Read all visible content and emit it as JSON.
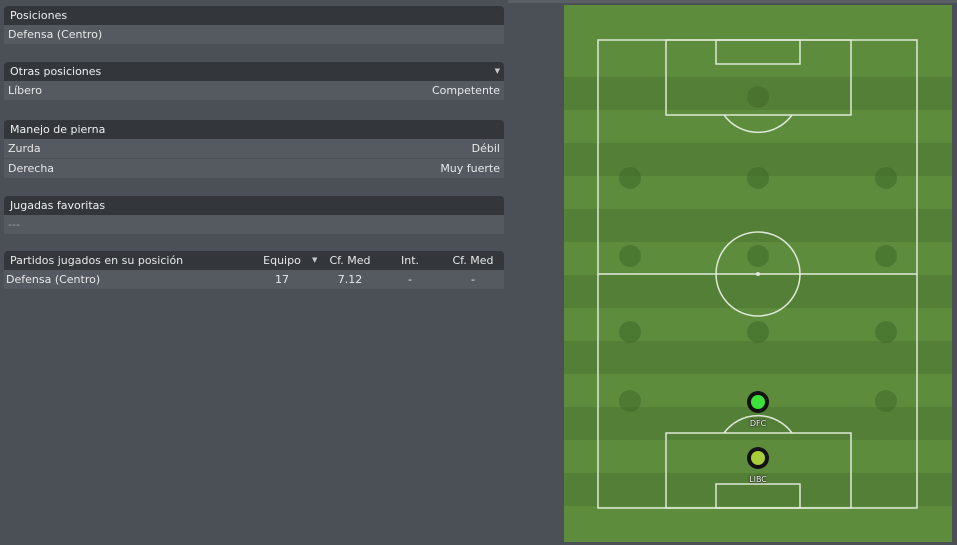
{
  "positions": {
    "title": "Posiciones",
    "value": "Defensa (Centro)"
  },
  "other_positions": {
    "title": "Otras posiciones",
    "rows": [
      {
        "label": "Líbero",
        "value": "Competente"
      }
    ]
  },
  "footedness": {
    "title": "Manejo de pierna",
    "rows": [
      {
        "label": "Zurda",
        "value": "Débil"
      },
      {
        "label": "Derecha",
        "value": "Muy fuerte"
      }
    ]
  },
  "favourite_moves": {
    "title": "Jugadas favoritas",
    "value": "---"
  },
  "matches_table": {
    "headers": [
      "Partidos jugados en su posición",
      "Equipo",
      "Cf. Med",
      "Int.",
      "Cf. Med"
    ],
    "rows": [
      {
        "position": "Defensa (Centro)",
        "team": "17",
        "avg_rating": "7.12",
        "int": "-",
        "int_avg": "-"
      }
    ]
  },
  "pitch": {
    "players": [
      {
        "label": "DFC",
        "color": "#3ee03a"
      },
      {
        "label": "LIBC",
        "color": "#a9cc3a"
      }
    ]
  },
  "colors": {
    "panel_bg": "#4b5056",
    "header_bg": "#33373b",
    "row_bg": "#555a60",
    "pitch_green": "#5b8a3c"
  }
}
